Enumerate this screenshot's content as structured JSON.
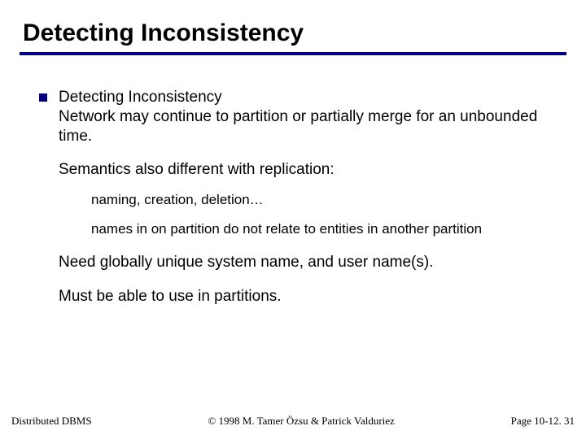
{
  "title": "Detecting Inconsistency",
  "bullet": {
    "heading": "Detecting Inconsistency",
    "line1": "Network may continue to partition or partially merge for an unbounded time."
  },
  "para_semantics": "Semantics also different with replication:",
  "sub1": "naming, creation, deletion…",
  "sub2": "names in on partition do not relate to entities in another partition",
  "para_need": "Need globally unique system name, and user name(s).",
  "para_must": "Must be able to use in partitions.",
  "footer": {
    "left": "Distributed DBMS",
    "center": "© 1998 M. Tamer Özsu & Patrick Valduriez",
    "right": "Page 10-12. 31"
  }
}
